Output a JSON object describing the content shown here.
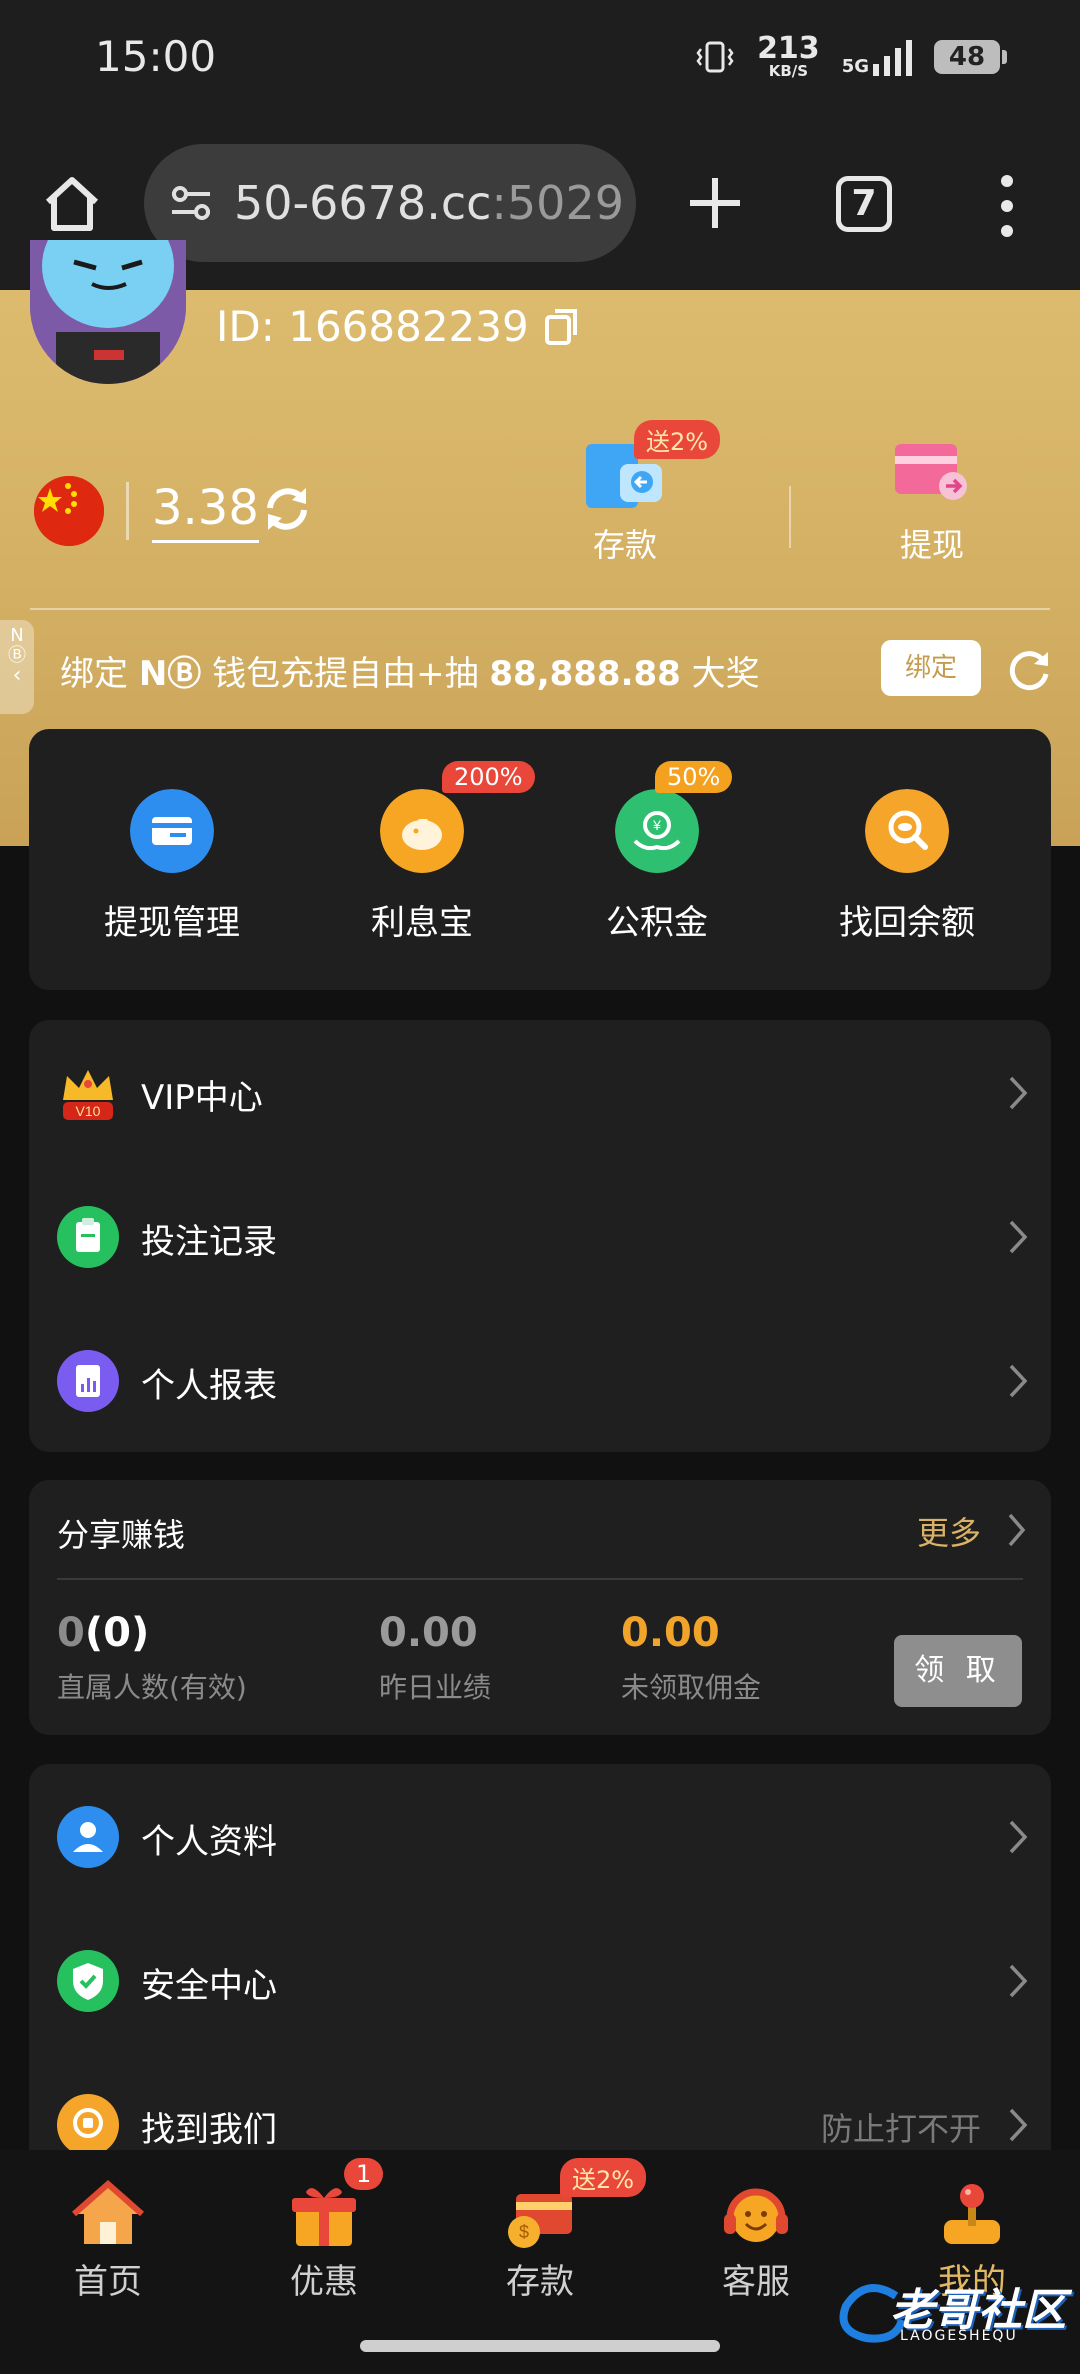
{
  "status_bar": {
    "time": "15:00",
    "net_speed": "213",
    "net_unit": "KB/S",
    "network": "5G",
    "battery": "48"
  },
  "browser": {
    "url_main": "50-6678.cc",
    "url_port": ":5029",
    "tab_count": "7"
  },
  "profile": {
    "user_id": "ID: 166882239",
    "balance": "3.38",
    "deposit_label": "存款",
    "deposit_badge": "送2%",
    "withdraw_label": "提现",
    "bind_prefix": "绑定 ",
    "bind_brand": "NⒷ",
    "bind_mid": " 钱包充提自由+抽 ",
    "bind_amount": "88,888.88",
    "bind_suffix": " 大奖",
    "bind_button": "绑定",
    "side_tab": "NⒷ"
  },
  "quick_actions": [
    {
      "label": "提现管理",
      "badge": "",
      "color": "#2e8ef0"
    },
    {
      "label": "利息宝",
      "badge": "200%",
      "color": "#f6a623"
    },
    {
      "label": "公积金",
      "badge": "50%",
      "color": "#2fbf71"
    },
    {
      "label": "找回余额",
      "badge": "",
      "color": "#f5a52a"
    }
  ],
  "menu_1": [
    {
      "label": "VIP中心",
      "icon": "crown-icon",
      "vip_level": "V10"
    },
    {
      "label": "投注记录",
      "icon": "clipboard-icon"
    },
    {
      "label": "个人报表",
      "icon": "report-icon"
    }
  ],
  "share": {
    "title": "分享赚钱",
    "more": "更多",
    "direct_count_main": "0",
    "direct_count_paren": "(0)",
    "direct_label": "直属人数(有效)",
    "yesterday_value": "0.00",
    "yesterday_label": "昨日业绩",
    "unclaimed_value": "0.00",
    "unclaimed_label": "未领取佣金",
    "claim_button": "领 取"
  },
  "menu_2": [
    {
      "label": "个人资料",
      "icon": "user-icon",
      "extra": ""
    },
    {
      "label": "安全中心",
      "icon": "shield-icon",
      "extra": ""
    },
    {
      "label": "找到我们",
      "icon": "find-us-icon",
      "extra": "防止打不开"
    }
  ],
  "bottom_nav": [
    {
      "label": "首页",
      "badge": ""
    },
    {
      "label": "优惠",
      "badge": "1"
    },
    {
      "label": "存款",
      "badge": "送2%"
    },
    {
      "label": "客服",
      "badge": ""
    },
    {
      "label": "我的",
      "badge": ""
    }
  ],
  "watermark": {
    "cn": "老哥社区",
    "en": "LAOGESHEQU"
  },
  "colors": {
    "gold": "#d4b064",
    "accent": "#e2b865",
    "card": "#1f1f1f",
    "badge_red": "#e9473a",
    "unclaimed": "#f0a42a"
  }
}
